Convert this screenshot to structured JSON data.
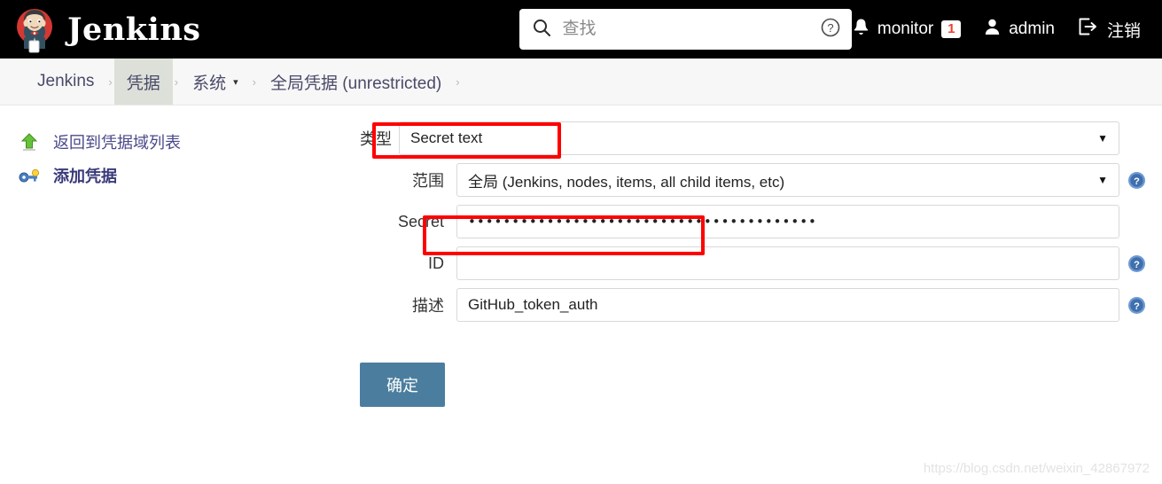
{
  "header": {
    "brand": "Jenkins",
    "logo_icon": "jenkins-butler-logo",
    "search": {
      "icon": "search-icon",
      "placeholder": "查找",
      "value": "",
      "help_icon": "question-circle-icon"
    },
    "notifications": {
      "icon": "bell-icon",
      "label": "monitor",
      "count": "1"
    },
    "user": {
      "icon": "user-icon",
      "label": "admin"
    },
    "logout": {
      "icon": "logout-icon",
      "label": "注销"
    }
  },
  "breadcrumb": {
    "items": [
      {
        "label": "Jenkins",
        "caret": "",
        "hovered": false
      },
      {
        "label": "凭据",
        "caret": "",
        "hovered": true
      },
      {
        "label": "系统",
        "caret": "▾",
        "hovered": false
      },
      {
        "label": "全局凭据 (unrestricted)",
        "caret": "",
        "hovered": false
      }
    ],
    "separator": "›"
  },
  "sidebar": {
    "items": [
      {
        "label": "返回到凭据域列表",
        "icon": "up-arrow-icon",
        "active": false
      },
      {
        "label": "添加凭据",
        "icon": "key-icon",
        "active": true
      }
    ]
  },
  "form": {
    "type": {
      "label": "类型",
      "value": "Secret text",
      "caret": "▼"
    },
    "scope": {
      "label": "范围",
      "value": "全局 (Jenkins, nodes, items, all child items, etc)",
      "caret": "▼",
      "help_icon": "help-icon"
    },
    "secret": {
      "label": "Secret",
      "value": "••••••••••••••••••••••••••••••••••••••••",
      "placeholder": ""
    },
    "id": {
      "label": "ID",
      "value": "",
      "placeholder": "",
      "help_icon": "help-icon"
    },
    "description": {
      "label": "描述",
      "value": "GitHub_token_auth",
      "placeholder": "",
      "help_icon": "help-icon"
    },
    "submit_label": "确定"
  },
  "annotations": {
    "color": "#ff0000",
    "boxes": [
      "type-field",
      "secret-field"
    ]
  },
  "watermark": "https://blog.csdn.net/weixin_42867972"
}
